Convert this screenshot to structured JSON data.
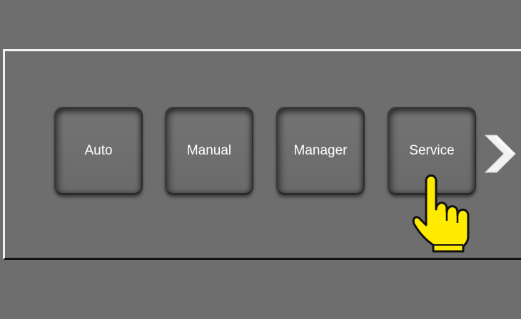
{
  "buttons": {
    "auto": "Auto",
    "manual": "Manual",
    "manager": "Manager",
    "service": "Service"
  },
  "icons": {
    "next": "chevron-right-icon",
    "pointer": "hand-pointer-icon"
  },
  "colors": {
    "background": "#6e6e6e",
    "button_text": "#ffffff",
    "hand_fill": "#ffeb00",
    "arrow": "#f2f2f2"
  }
}
